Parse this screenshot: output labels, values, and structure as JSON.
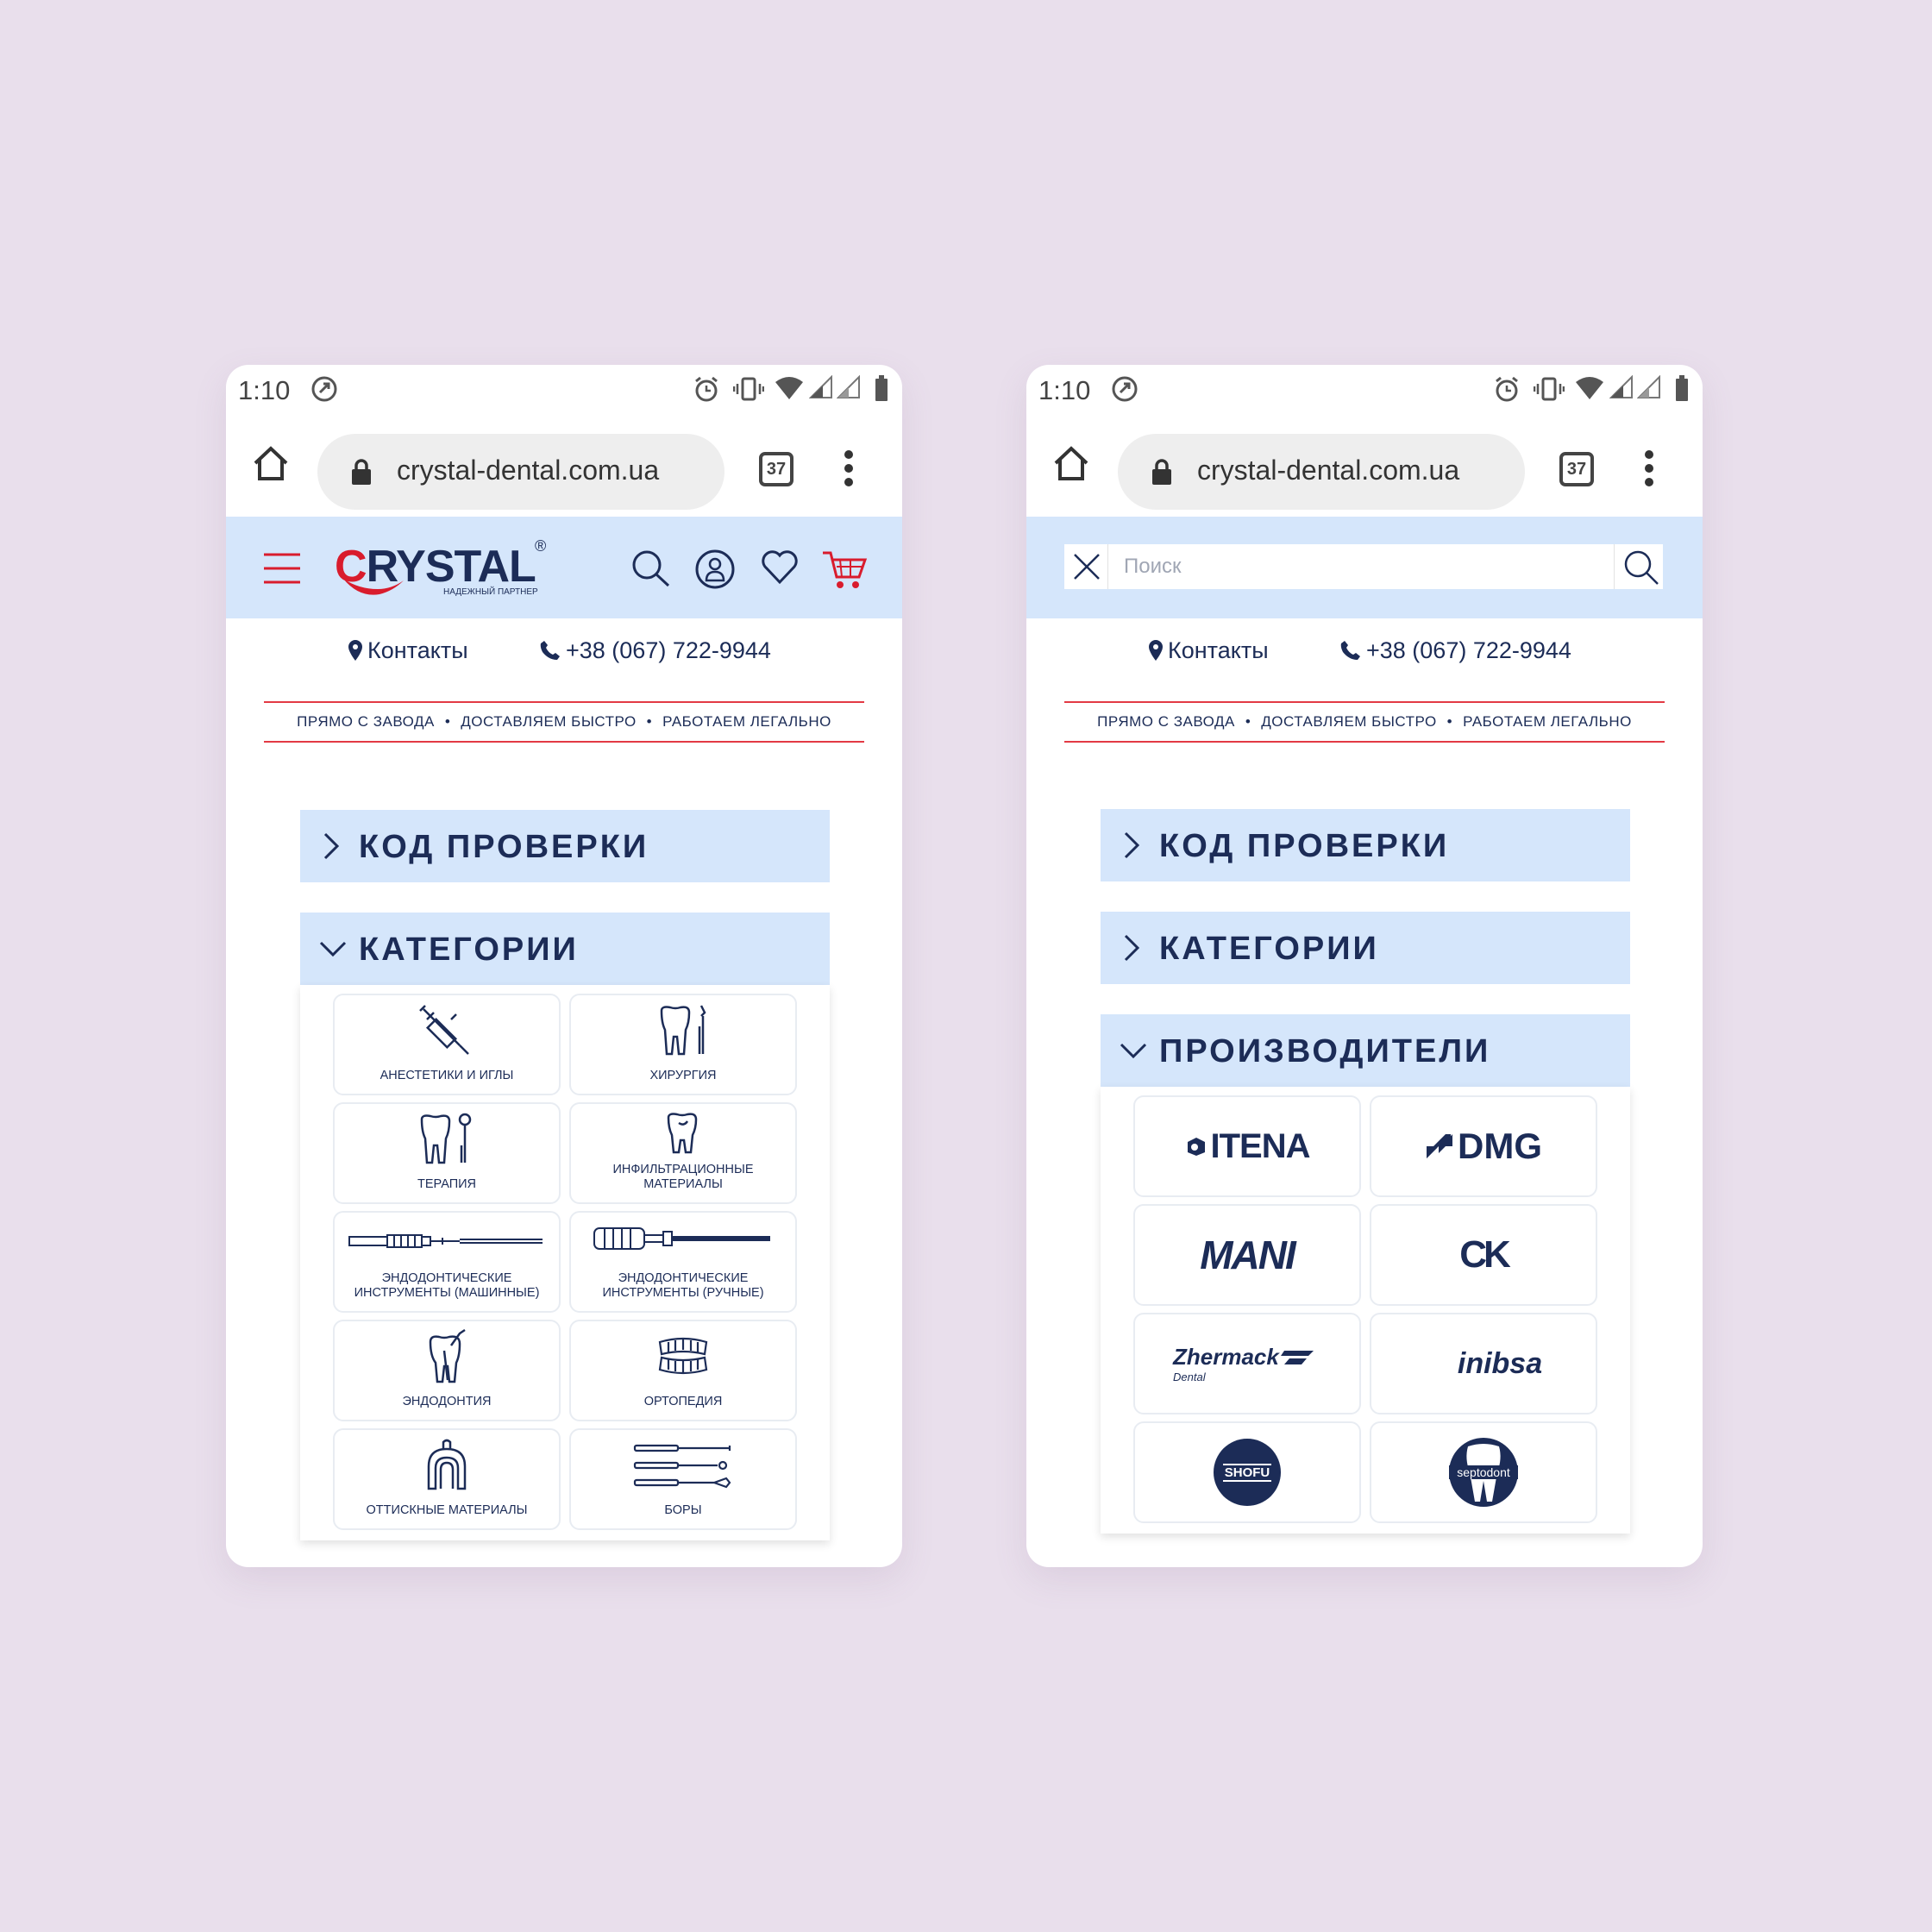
{
  "status_bar": {
    "time": "1:10"
  },
  "browser": {
    "url": "crystal-dental.com.ua",
    "tab_count": "37"
  },
  "site": {
    "logo": {
      "text_c": "C",
      "text_rest": "RYSTAL",
      "reg": "®",
      "tagline": "НАДЕЖНЫЙ ПАРТНЕР"
    },
    "contacts_label": "Контакты",
    "phone": "+38 (067) 722-9944",
    "promo": [
      "ПРЯМО С ЗАВОДА",
      "ДОСТАВЛЯЕМ БЫСТРО",
      "РАБОТАЕМ ЛЕГАЛЬНО"
    ],
    "promo_sep": "•",
    "search_placeholder": "Поиск"
  },
  "accordion": {
    "code_check": "КОД ПРОВЕРКИ",
    "categories": "КАТЕГОРИИ",
    "manufacturers": "ПРОИЗВОДИТЕЛИ"
  },
  "categories": [
    {
      "label_line1": "АНЕСТЕТИКИ И ИГЛЫ",
      "label_line2": "",
      "icon": "syringe-icon"
    },
    {
      "label_line1": "ХИРУРГИЯ",
      "label_line2": "",
      "icon": "tooth-tool-icon"
    },
    {
      "label_line1": "ТЕРАПИЯ",
      "label_line2": "",
      "icon": "tooth-mirror-icon"
    },
    {
      "label_line1": "ИНФИЛЬТРАЦИОННЫЕ",
      "label_line2": "МАТЕРИАЛЫ",
      "icon": "tooth-icon"
    },
    {
      "label_line1": "ЭНДОДОНТИЧЕСКИЕ",
      "label_line2": "ИНСТРУМЕНТЫ (МАШИННЫЕ)",
      "icon": "machine-file-icon"
    },
    {
      "label_line1": "ЭНДОДОНТИЧЕСКИЕ",
      "label_line2": "ИНСТРУМЕНТЫ (РУЧНЫЕ)",
      "icon": "hand-file-icon"
    },
    {
      "label_line1": "ЭНДОДОНТИЯ",
      "label_line2": "",
      "icon": "tooth-root-icon"
    },
    {
      "label_line1": "ОРТОПЕДИЯ",
      "label_line2": "",
      "icon": "dentures-icon"
    },
    {
      "label_line1": "ОТТИСКНЫЕ МАТЕРИАЛЫ",
      "label_line2": "",
      "icon": "impression-tray-icon"
    },
    {
      "label_line1": "БОРЫ",
      "label_line2": "",
      "icon": "burs-icon"
    }
  ],
  "manufacturers": [
    {
      "name": "ITENA"
    },
    {
      "name": "DMG"
    },
    {
      "name": "MANI"
    },
    {
      "name": "CK"
    },
    {
      "name": "Zhermack",
      "sub": "Dental"
    },
    {
      "name": "inibsa"
    },
    {
      "name": "SHOFU"
    },
    {
      "name": "septodont"
    }
  ],
  "colors": {
    "accent_red": "#d91c2d",
    "navy": "#1c2c57",
    "header_blue": "#d5e6fb",
    "background": "#e9dfec"
  }
}
